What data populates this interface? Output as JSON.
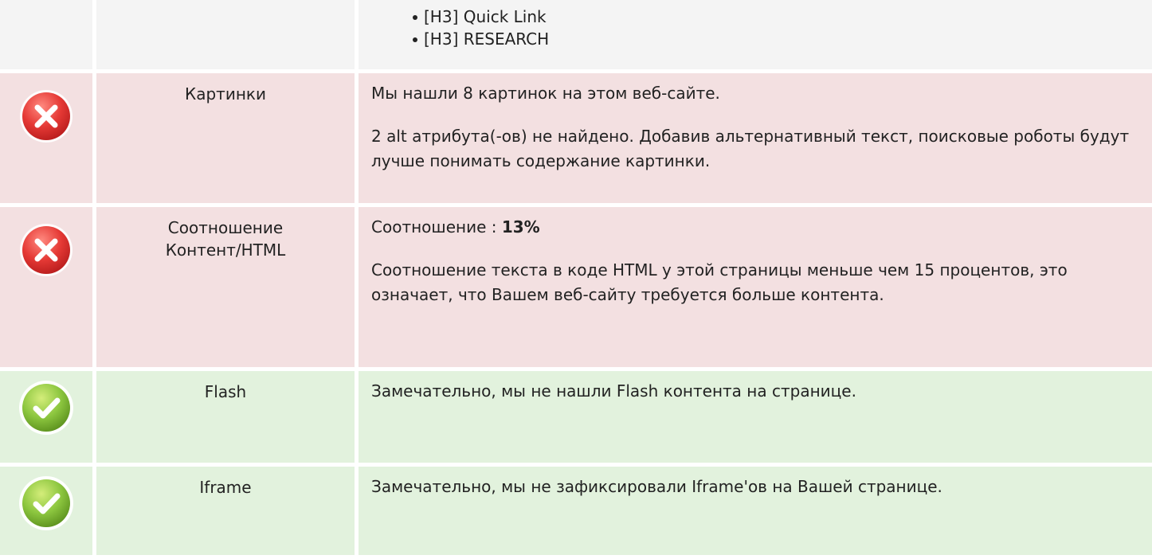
{
  "headings_list": [
    "[H3] Quick Link",
    "[H3] RESEARCH"
  ],
  "rows": [
    {
      "status": "error",
      "name": "Картинки",
      "p1": "Мы нашли 8 картинок на этом веб-сайте.",
      "p2": "2 alt атрибута(-ов) не найдено. Добавив альтернативный текст, поисковые роботы будут лучше понимать содержание картинки."
    },
    {
      "status": "error",
      "name": "Соотношение Контент/HTML",
      "p1_label": "Соотношение : ",
      "p1_value": "13%",
      "p2": "Соотношение текста в коде HTML у этой страницы меньше чем 15 процентов, это означает, что Вашем веб-сайту требуется больше контента."
    },
    {
      "status": "ok",
      "name": "Flash",
      "p1": "Замечательно, мы не нашли Flash контента на странице."
    },
    {
      "status": "ok",
      "name": "Iframe",
      "p1": "Замечательно, мы не зафиксировали Iframe'ов на Вашей странице."
    }
  ],
  "icons": {
    "error": "error-x-icon",
    "ok": "checkmark-icon"
  },
  "colors": {
    "neutral_bg": "#f4f4f4",
    "error_bg": "#f3e0e1",
    "ok_bg": "#e2f2dd",
    "error_icon": "#e23b3b",
    "ok_icon": "#8cc63f"
  }
}
